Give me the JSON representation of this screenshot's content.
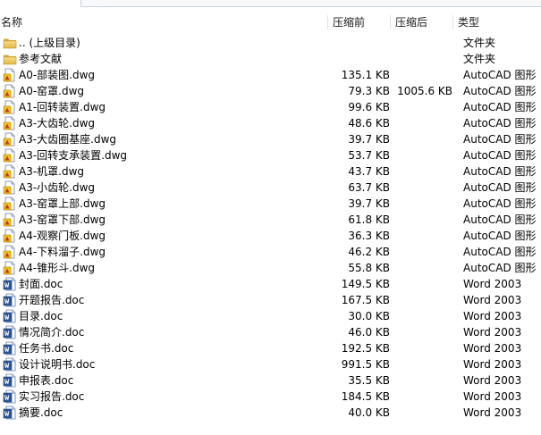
{
  "columns": {
    "name": "名称",
    "compressed_size": "压缩前",
    "original_size": "压缩后",
    "type": "类型"
  },
  "files": [
    {
      "name": ".. (上级目录)",
      "compressed_size": "",
      "original_size": "",
      "type": "文件夹",
      "icon": "folder-icon"
    },
    {
      "name": "参考文献",
      "compressed_size": "",
      "original_size": "",
      "type": "文件夹",
      "icon": "folder-icon"
    },
    {
      "name": "A0-部装图.dwg",
      "compressed_size": "135.1 KB",
      "original_size": "",
      "type": "AutoCAD 图形",
      "icon": "dwg-file-icon"
    },
    {
      "name": "A0-窑罩.dwg",
      "compressed_size": "79.3 KB",
      "original_size": "1005.6 KB",
      "type": "AutoCAD 图形",
      "icon": "dwg-file-icon"
    },
    {
      "name": "A1-回转装置.dwg",
      "compressed_size": "99.6 KB",
      "original_size": "",
      "type": "AutoCAD 图形",
      "icon": "dwg-file-icon"
    },
    {
      "name": "A3-大齿轮.dwg",
      "compressed_size": "48.6 KB",
      "original_size": "",
      "type": "AutoCAD 图形",
      "icon": "dwg-file-icon"
    },
    {
      "name": "A3-大齿圈基座.dwg",
      "compressed_size": "39.7 KB",
      "original_size": "",
      "type": "AutoCAD 图形",
      "icon": "dwg-file-icon"
    },
    {
      "name": "A3-回转支承装置.dwg",
      "compressed_size": "53.7 KB",
      "original_size": "",
      "type": "AutoCAD 图形",
      "icon": "dwg-file-icon"
    },
    {
      "name": "A3-机罩.dwg",
      "compressed_size": "43.7 KB",
      "original_size": "",
      "type": "AutoCAD 图形",
      "icon": "dwg-file-icon"
    },
    {
      "name": "A3-小齿轮.dwg",
      "compressed_size": "63.7 KB",
      "original_size": "",
      "type": "AutoCAD 图形",
      "icon": "dwg-file-icon"
    },
    {
      "name": "A3-窑罩上部.dwg",
      "compressed_size": "39.7 KB",
      "original_size": "",
      "type": "AutoCAD 图形",
      "icon": "dwg-file-icon"
    },
    {
      "name": "A3-窑罩下部.dwg",
      "compressed_size": "61.8 KB",
      "original_size": "",
      "type": "AutoCAD 图形",
      "icon": "dwg-file-icon"
    },
    {
      "name": "A4-观察门板.dwg",
      "compressed_size": "36.3 KB",
      "original_size": "",
      "type": "AutoCAD 图形",
      "icon": "dwg-file-icon"
    },
    {
      "name": "A4-下料溜子.dwg",
      "compressed_size": "46.2 KB",
      "original_size": "",
      "type": "AutoCAD 图形",
      "icon": "dwg-file-icon"
    },
    {
      "name": "A4-锥形斗.dwg",
      "compressed_size": "55.8 KB",
      "original_size": "",
      "type": "AutoCAD 图形",
      "icon": "dwg-file-icon"
    },
    {
      "name": "封面.doc",
      "compressed_size": "149.5 KB",
      "original_size": "",
      "type": "Word 2003",
      "icon": "word-doc-icon"
    },
    {
      "name": "开题报告.doc",
      "compressed_size": "167.5 KB",
      "original_size": "",
      "type": "Word 2003",
      "icon": "word-doc-icon"
    },
    {
      "name": "目录.doc",
      "compressed_size": "30.0 KB",
      "original_size": "",
      "type": "Word 2003",
      "icon": "word-doc-icon"
    },
    {
      "name": "情况简介.doc",
      "compressed_size": "46.0 KB",
      "original_size": "",
      "type": "Word 2003",
      "icon": "word-doc-icon"
    },
    {
      "name": "任务书.doc",
      "compressed_size": "192.5 KB",
      "original_size": "",
      "type": "Word 2003",
      "icon": "word-doc-icon"
    },
    {
      "name": "设计说明书.doc",
      "compressed_size": "991.5 KB",
      "original_size": "",
      "type": "Word 2003",
      "icon": "word-doc-icon"
    },
    {
      "name": "申报表.doc",
      "compressed_size": "35.5 KB",
      "original_size": "",
      "type": "Word 2003",
      "icon": "word-doc-icon"
    },
    {
      "name": "实习报告.doc",
      "compressed_size": "184.5 KB",
      "original_size": "",
      "type": "Word 2003",
      "icon": "word-doc-icon"
    },
    {
      "name": "摘要.doc",
      "compressed_size": "40.0 KB",
      "original_size": "",
      "type": "Word 2003",
      "icon": "word-doc-icon"
    }
  ]
}
